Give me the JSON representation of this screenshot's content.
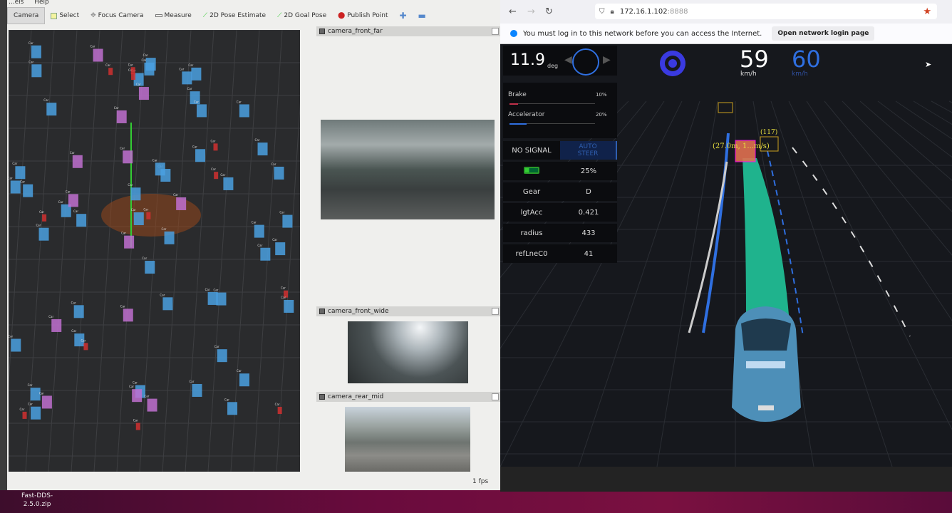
{
  "rviz": {
    "menu": [
      "...els",
      "Help"
    ],
    "tools": [
      {
        "label": "Camera",
        "icon": "camera-icon",
        "active": true
      },
      {
        "label": "Select",
        "icon": "select-icon"
      },
      {
        "label": "Focus Camera",
        "icon": "focus-icon"
      },
      {
        "label": "Measure",
        "icon": "ruler-icon"
      },
      {
        "label": "2D Pose Estimate",
        "icon": "pose-arrow-icon"
      },
      {
        "label": "2D Goal Pose",
        "icon": "goal-arrow-icon"
      },
      {
        "label": "Publish Point",
        "icon": "map-pin-icon"
      }
    ],
    "panels": [
      {
        "title": "camera_front_far"
      },
      {
        "title": "camera_front_wide"
      },
      {
        "title": "camera_rear_mid"
      }
    ],
    "fps": "1 fps"
  },
  "desktop": {
    "file_label_1": "Fast-DDS-",
    "file_label_2": "2.5.0.zip"
  },
  "browser": {
    "url_host": "172.16.1.102",
    "url_port": ":8888",
    "notification": "You must log in to this network before you can access the Internet.",
    "notification_button": "Open network login page"
  },
  "dashboard": {
    "steering_angle": "11.9",
    "steering_unit": "deg",
    "speed": "59",
    "speed_unit": "km/h",
    "set_speed": "60",
    "set_speed_unit": "km/h",
    "brake_label": "Brake",
    "brake_value": "10%",
    "brake_fraction": 0.1,
    "accel_label": "Accelerator",
    "accel_value": "20%",
    "accel_fraction": 0.2,
    "signal": "NO SIGNAL",
    "auto_steer_1": "AUTO",
    "auto_steer_2": "STEER",
    "battery": "25%",
    "rows": [
      {
        "k": "Gear",
        "v": "D"
      },
      {
        "k": "lgtAcc",
        "v": "0.421"
      },
      {
        "k": "radius",
        "v": "433"
      },
      {
        "k": "refLneC0",
        "v": "41"
      }
    ],
    "obstacle_labels": [
      "(27.0m, 1...m/s)",
      "(117)"
    ],
    "colors": {
      "accent_blue": "#2f6fe0",
      "path_green": "#1fb38d",
      "brake_red": "#c0304a",
      "wheel_icon": "#3a3ae0"
    }
  }
}
